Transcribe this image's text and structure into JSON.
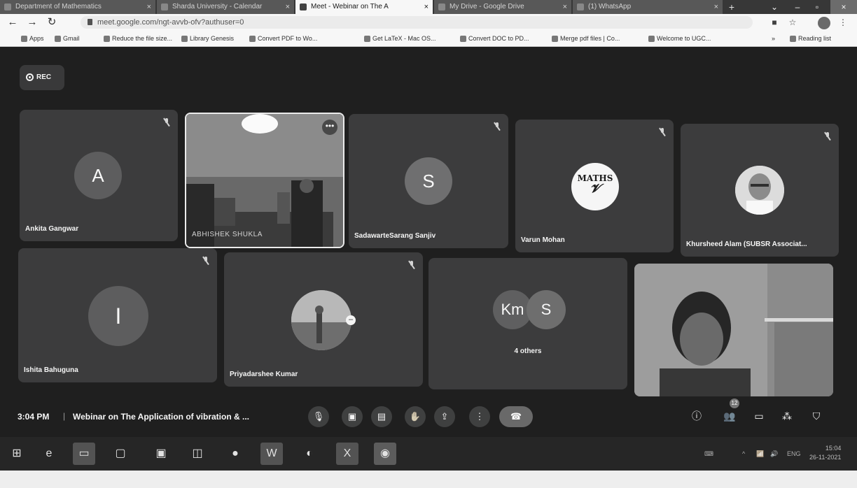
{
  "browser": {
    "tabs": [
      {
        "label": "Department of Mathematics"
      },
      {
        "label": "Sharda University - Calendar"
      },
      {
        "label": "Meet - Webinar on The A"
      },
      {
        "label": "My Drive - Google Drive"
      },
      {
        "label": "(1) WhatsApp"
      }
    ],
    "new_tab_label": "+",
    "url": "meet.google.com/ngt-avvb-ofv?authuser=0",
    "bookmarks": [
      {
        "label": "Apps"
      },
      {
        "label": "Gmail"
      },
      {
        "label": "Reduce the file size..."
      },
      {
        "label": "Library Genesis"
      },
      {
        "label": "Convert PDF to Wo..."
      },
      {
        "label": "Get LaTeX - Mac OS..."
      },
      {
        "label": "Convert DOC to PD..."
      },
      {
        "label": "Merge pdf files | Co..."
      },
      {
        "label": "Welcome to UGC..."
      }
    ],
    "more_bookmarks": "»",
    "reading_list": "Reading list"
  },
  "meet": {
    "rec_label": "REC",
    "participants": [
      {
        "name": "Ankita Gangwar",
        "initial": "A"
      },
      {
        "name": "ABHISHEK SHUKLA"
      },
      {
        "name": "SadawarteSarang Sanjiv",
        "initial": "S"
      },
      {
        "name": "Varun Mohan",
        "logo_text": "MATHS"
      },
      {
        "name": "Khursheed Alam (SUBSR Associat..."
      },
      {
        "name": "Ishita Bahuguna",
        "initial": "I"
      },
      {
        "name": "Priyadarshee Kumar"
      }
    ],
    "others_tile": {
      "initials": [
        "Km",
        "S"
      ],
      "label": "4 others"
    },
    "time": "3:04 PM",
    "separator": "|",
    "meeting_title": "Webinar on The Application of vibration & ...",
    "participant_count": "12"
  },
  "taskbar": {
    "language": "ENG",
    "clock_time": "15:04",
    "clock_date": "26-11-2021"
  }
}
